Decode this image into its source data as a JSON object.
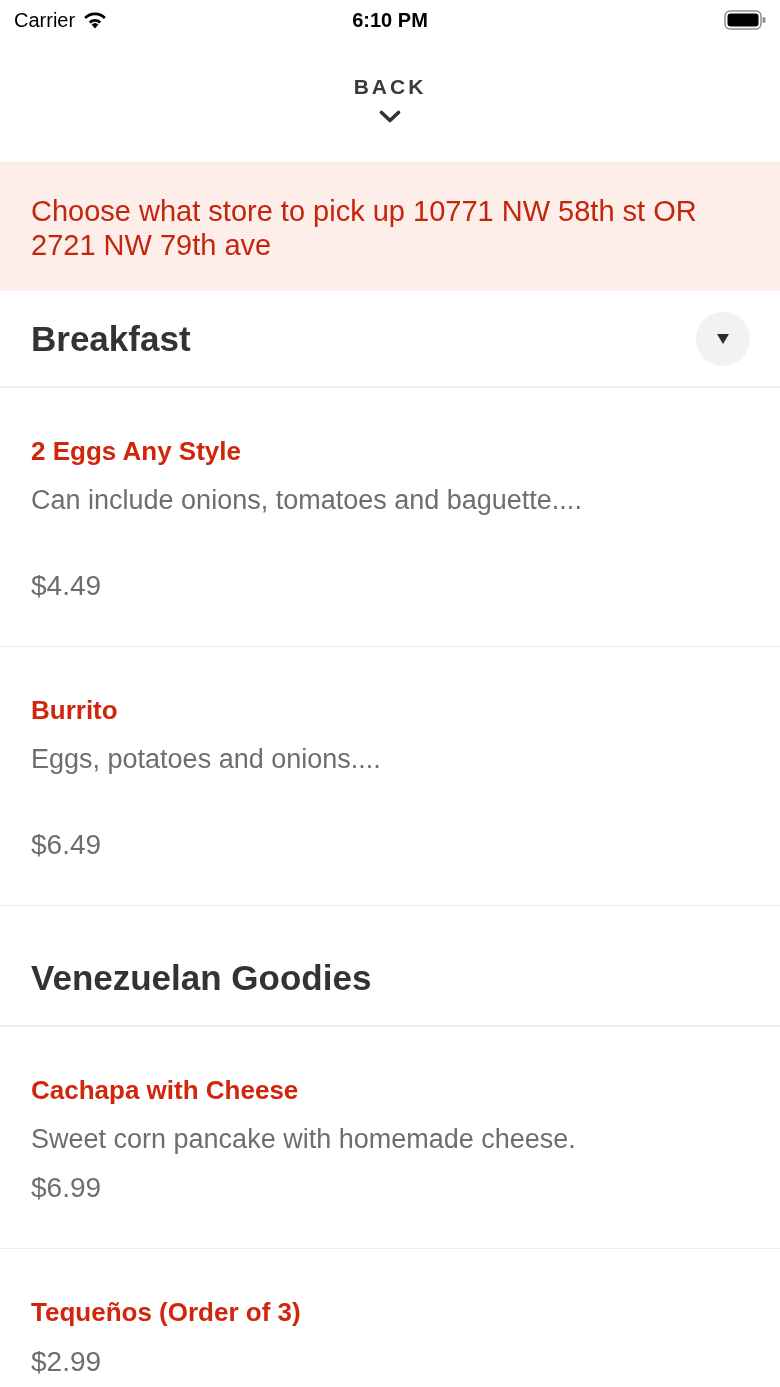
{
  "status_bar": {
    "carrier": "Carrier",
    "time": "6:10 PM"
  },
  "nav": {
    "back_label": "BACK"
  },
  "notice": "Choose what store to pick up 10771 NW 58th st OR 2721 NW 79th ave",
  "sections": [
    {
      "title": "Breakfast",
      "kind": "collapsible",
      "expanded": true,
      "items": [
        {
          "name": "2 Eggs Any Style",
          "description": "Can include onions, tomatoes and baguette....",
          "price": "$4.49"
        },
        {
          "name": "Burrito",
          "description": "Eggs, potatoes and onions....",
          "price": "$6.49"
        }
      ]
    },
    {
      "title": "Venezuelan Goodies",
      "kind": "plain",
      "items": [
        {
          "name": "Cachapa with Cheese",
          "description": "Sweet corn pancake with homemade cheese.",
          "price": "$6.99"
        },
        {
          "name": "Tequeños (Order of 3)",
          "price": "$2.99"
        }
      ]
    }
  ]
}
